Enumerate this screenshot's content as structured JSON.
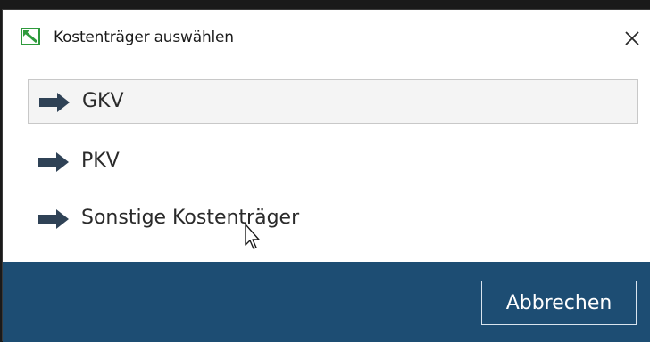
{
  "dialog": {
    "title": "Kostenträger auswählen",
    "app_icon": "document-icon",
    "close_icon": "close-icon"
  },
  "options": [
    {
      "label": "GKV",
      "icon": "arrow-right-icon",
      "selected": true
    },
    {
      "label": "PKV",
      "icon": "arrow-right-icon",
      "selected": false
    },
    {
      "label": "Sonstige Kostenträger",
      "icon": "arrow-right-icon",
      "selected": false
    }
  ],
  "footer": {
    "cancel_label": "Abbrechen"
  },
  "colors": {
    "footer_bg": "#1d4d73",
    "arrow": "#2f4256",
    "icon_green": "#2e9a3c"
  }
}
